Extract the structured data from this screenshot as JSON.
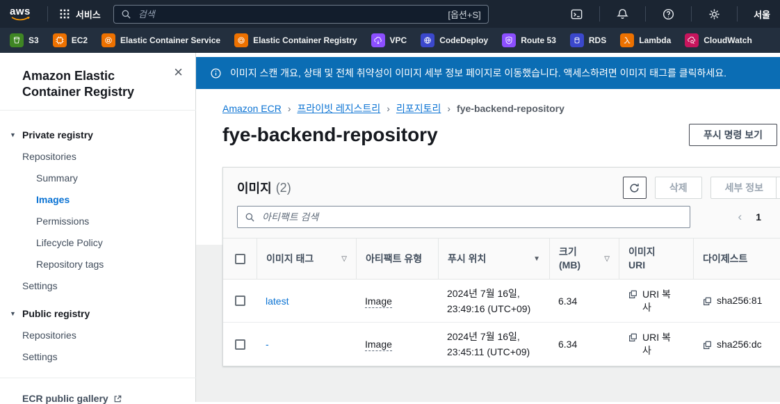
{
  "topbar": {
    "logo": "aws",
    "services_label": "서비스",
    "search_placeholder": "검색",
    "search_shortcut": "[옵션+S]",
    "region": "서울"
  },
  "favorites": [
    {
      "label": "S3",
      "color": "#3F8624"
    },
    {
      "label": "EC2",
      "color": "#ED7100"
    },
    {
      "label": "Elastic Container Service",
      "color": "#ED7100"
    },
    {
      "label": "Elastic Container Registry",
      "color": "#ED7100"
    },
    {
      "label": "VPC",
      "color": "#8C4FFF"
    },
    {
      "label": "CodeDeploy",
      "color": "#3B48CC"
    },
    {
      "label": "Route 53",
      "color": "#8C4FFF"
    },
    {
      "label": "RDS",
      "color": "#3B48CC"
    },
    {
      "label": "Lambda",
      "color": "#ED7100"
    },
    {
      "label": "CloudWatch",
      "color": "#C7155D"
    }
  ],
  "banner": {
    "text": "이미지 스캔 개요, 상태 및 전체 취약성이 이미지 세부 정보 페이지로 이동했습니다. 액세스하려면 이미지 태그를 클릭하세요.",
    "color": "#0b6db4"
  },
  "sidebar": {
    "title": "Amazon Elastic Container Registry",
    "private": {
      "header": "Private registry",
      "items": [
        "Repositories",
        "Summary",
        "Images",
        "Permissions",
        "Lifecycle Policy",
        "Repository tags",
        "Settings"
      ]
    },
    "public": {
      "header": "Public registry",
      "items": [
        "Repositories",
        "Settings"
      ]
    },
    "footer_link": "ECR public gallery",
    "active_item": "Images"
  },
  "breadcrumb": {
    "items": [
      "Amazon ECR",
      "프라이빗 레지스트리",
      "리포지토리",
      "fye-backend-repository"
    ],
    "separator": "›"
  },
  "page": {
    "title": "fye-backend-repository",
    "push_commands_button": "푸시 명령 보기"
  },
  "panel": {
    "heading": "이미지",
    "count": "(2)",
    "delete_button": "삭제",
    "details_button": "세부 정보",
    "search_placeholder": "아티팩트 검색",
    "pagination": {
      "prev": "‹",
      "page": "1"
    }
  },
  "table": {
    "columns": [
      {
        "label": "이미지 태그",
        "sort": "none",
        "sort_icon": "▽"
      },
      {
        "label": "아티팩트 유형",
        "sort": null
      },
      {
        "label": "푸시 위치",
        "sort": "desc",
        "sort_icon": "▼"
      },
      {
        "label": "크기 (MB)",
        "sort": "none",
        "sort_icon": "▽"
      },
      {
        "label": "이미지 URI",
        "sort": null
      },
      {
        "label": "다이제스트",
        "sort": null
      }
    ],
    "rows": [
      {
        "tag": "latest",
        "type": "Image",
        "pushed_date": "2024년 7월 16일,",
        "pushed_time": "23:49:16 (UTC+09)",
        "size": "6.34",
        "uri_button": "URI 복사",
        "digest": "sha256:81"
      },
      {
        "tag": "-",
        "type": "Image",
        "pushed_date": "2024년 7월 16일,",
        "pushed_time": "23:45:11 (UTC+09)",
        "size": "6.34",
        "uri_button": "URI 복사",
        "digest": "sha256:dc"
      }
    ]
  },
  "colors": {
    "link": "#0972d3",
    "topbar": "#1b2532",
    "favbar": "#232f3e",
    "content_bg": "#eff0f0"
  }
}
